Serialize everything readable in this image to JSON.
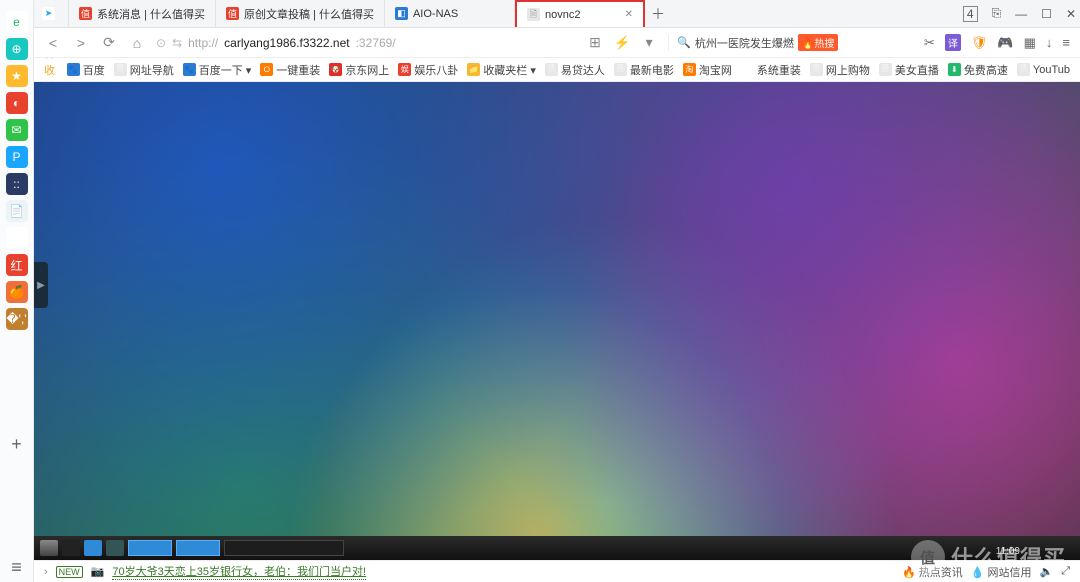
{
  "sidebar": {
    "plus": "+",
    "menu": "≡",
    "items": [
      {
        "bg": "#ffffff",
        "label": "e",
        "color": "#1fb85c",
        "name": "browser-logo-icon"
      },
      {
        "bg": "#18c7c0",
        "label": "⊕",
        "name": "side-app-1"
      },
      {
        "bg": "#ffb92e",
        "label": "★",
        "name": "side-favorites"
      },
      {
        "bg": "#e8422f",
        "label": "◐",
        "name": "side-weibo"
      },
      {
        "bg": "#31c24a",
        "label": "✉",
        "name": "side-mail"
      },
      {
        "bg": "#1aa6ff",
        "label": "P",
        "name": "side-app-p"
      },
      {
        "bg": "#2a3b66",
        "label": "::",
        "name": "side-app-grid"
      },
      {
        "bg": "#eef3f8",
        "label": "📄",
        "color": "#5a7",
        "name": "side-doc"
      },
      {
        "bg": "#ffffff",
        "label": "",
        "name": "side-spacer"
      },
      {
        "bg": "#e8422f",
        "label": "红",
        "name": "side-xiaohongshu"
      },
      {
        "bg": "#f07038",
        "label": "🍊",
        "name": "side-app-orange"
      },
      {
        "bg": "#c08030",
        "label": "�','",
        "name": "side-app-game"
      }
    ]
  },
  "tabs": {
    "count": "4",
    "newtab": "＋",
    "items": [
      {
        "icon_bg": "#ffffff",
        "icon_txt": "➤",
        "icon_color": "#1aa6ff",
        "label": ""
      },
      {
        "icon_bg": "#e8422f",
        "icon_txt": "值",
        "icon_color": "#fff",
        "label": "系统消息 | 什么值得买"
      },
      {
        "icon_bg": "#e8422f",
        "icon_txt": "值",
        "icon_color": "#fff",
        "label": "原创文章投稿 | 什么值得买"
      },
      {
        "icon_bg": "#2a7bd4",
        "icon_txt": "◧",
        "icon_color": "#fff",
        "label": "AIO-NAS"
      },
      {
        "icon_bg": "#e7e7e7",
        "icon_txt": "🗎",
        "icon_color": "#888",
        "label": "novnc2",
        "active": true,
        "close": "✕"
      }
    ]
  },
  "addr": {
    "back": "<",
    "fwd": ">",
    "reload": "⟳",
    "home": "⌂",
    "shield": "⊙",
    "cast": "⇆",
    "url_dim1": "http://",
    "url_dark": "carlyang1986.f3322.net",
    "url_dim2": ":32769/",
    "qr": "⊞",
    "bolt": "⚡",
    "drop": "▾",
    "search_icon": "🔍",
    "search_text": "杭州一医院发生爆燃",
    "hot": "🔥热搜"
  },
  "tools": {
    "scissors": "✂",
    "translate": "译",
    "shield": "🛡",
    "game": "🎮",
    "grid": "▦",
    "down": "↓",
    "menu": "≡"
  },
  "bookmarks": {
    "star": "★ 收藏",
    "items": [
      {
        "bg": "#2a7bd4",
        "txt": "🐾",
        "label": "百度"
      },
      {
        "bg": "#e7e7e7",
        "txt": "🗎",
        "label": "网址导航"
      },
      {
        "bg": "#2a7bd4",
        "txt": "🐾",
        "label": "百度一下 ▾"
      },
      {
        "bg": "#ff7a00",
        "txt": "⭘",
        "label": "一键重装"
      },
      {
        "bg": "#e22b2b",
        "txt": "🐶",
        "label": "京东网上"
      },
      {
        "bg": "#e8422f",
        "txt": "娱",
        "label": "娱乐八卦"
      },
      {
        "bg": "#f5b92e",
        "txt": "📁",
        "label": "收藏夹栏 ▾"
      },
      {
        "bg": "#e7e7e7",
        "txt": "🗎",
        "label": "易贷达人"
      },
      {
        "bg": "#e7e7e7",
        "txt": "🗎",
        "label": "最新电影"
      },
      {
        "bg": "#ff7a00",
        "txt": "淘",
        "label": "淘宝网"
      },
      {
        "bg": "#ffffff",
        "txt": "❖",
        "label": "系统重装"
      },
      {
        "bg": "#e7e7e7",
        "txt": "🗎",
        "label": "网上购物"
      },
      {
        "bg": "#e7e7e7",
        "txt": "🗎",
        "label": "美女直播"
      },
      {
        "bg": "#22b96b",
        "txt": "⬇",
        "label": "免费高速"
      },
      {
        "bg": "#e7e7e7",
        "txt": "🗎",
        "label": "YouTub"
      }
    ]
  },
  "vnc": {
    "handle": "▶",
    "clock": "11:09"
  },
  "status": {
    "badge": "NEW",
    "cam": "📷",
    "news": "70岁大爷3天恋上35岁银行女，老伯：我们门当户对!",
    "hot": "🔥 热点资讯",
    "cred": "💧 网站信用",
    "speaker": "🔈",
    "expand": "⤢"
  },
  "watermark": {
    "circle": "值",
    "text": "什么值得买"
  }
}
